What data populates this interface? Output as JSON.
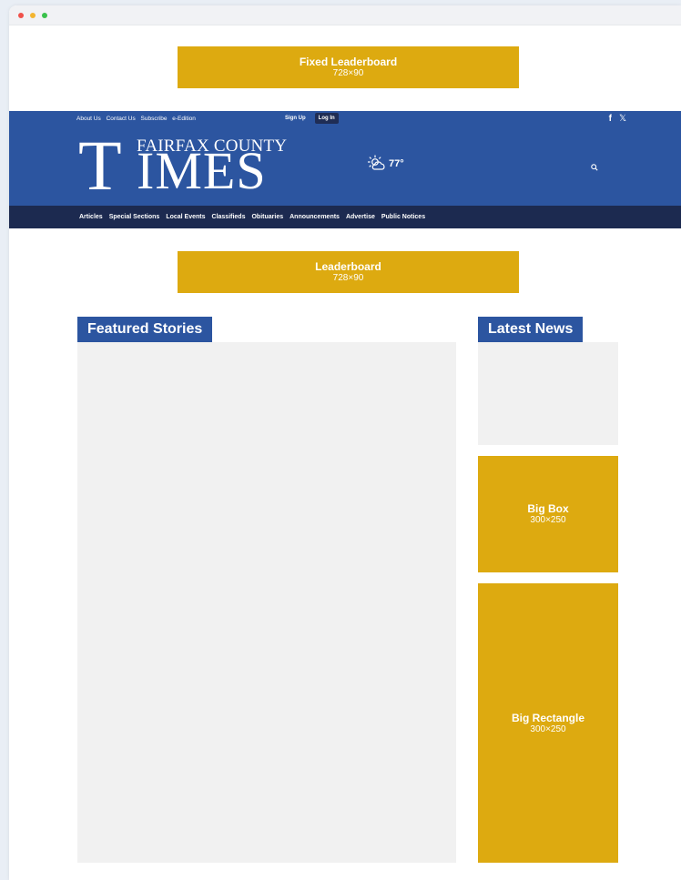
{
  "ads": {
    "fixed": {
      "title": "Fixed Leaderboard",
      "size": "728×90"
    },
    "leaderboard": {
      "title": "Leaderboard",
      "size": "728×90"
    },
    "bigbox": {
      "title": "Big Box",
      "size": "300×250"
    },
    "bigrect": {
      "title": "Big Rectangle",
      "size": "300×250"
    }
  },
  "topnav": {
    "about": "About Us",
    "contact": "Contact Us",
    "subscribe": "Subscribe",
    "edition": "e-Edition"
  },
  "auth": {
    "signup": "Sign Up",
    "login": "Log In"
  },
  "social": {
    "facebook": "f",
    "x": "𝕏"
  },
  "logo": {
    "t": "T",
    "county": "FAIRFAX COUNTY",
    "imes": "IMES"
  },
  "weather": {
    "temp": "77°",
    "icon": "partly-cloudy-icon"
  },
  "nav": [
    "Articles",
    "Special Sections",
    "Local Events",
    "Classifieds",
    "Obituaries",
    "Announcements",
    "Advertise",
    "Public Notices"
  ],
  "sections": {
    "featured": "Featured Stories",
    "latest": "Latest News"
  },
  "colors": {
    "brand_blue": "#2c55a0",
    "nav_dark": "#1c2a50",
    "ad_gold": "#ddaa10"
  }
}
